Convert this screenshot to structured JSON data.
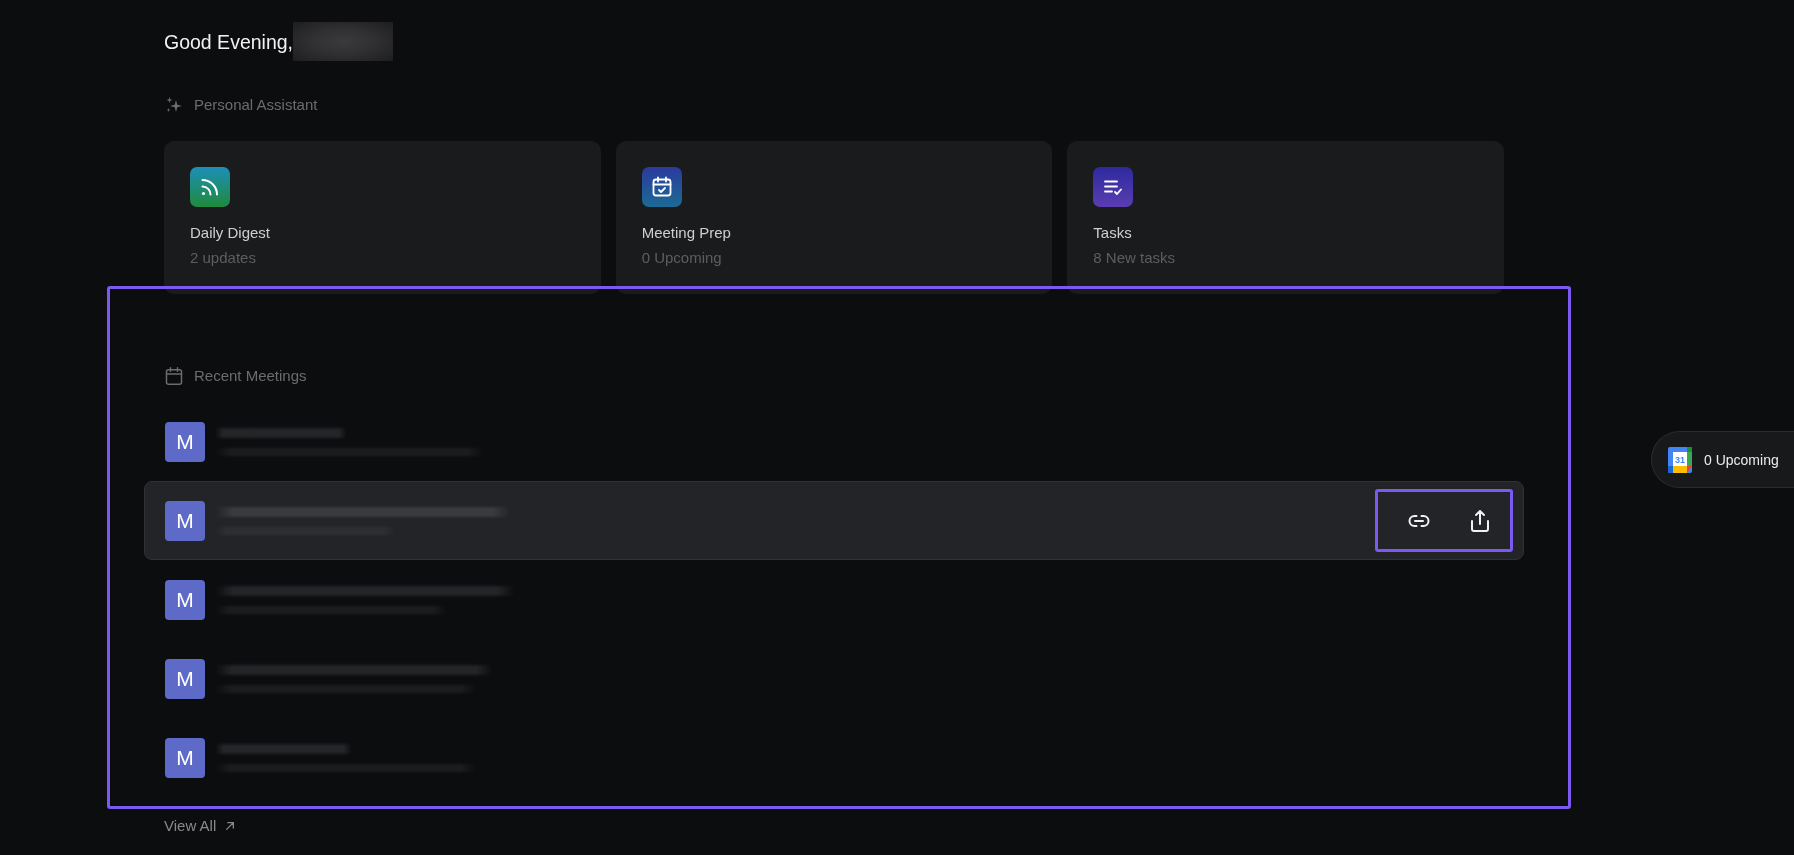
{
  "greeting": {
    "text": "Good Evening,",
    "name_redacted": true
  },
  "personal_assistant": {
    "title": "Personal Assistant",
    "cards": [
      {
        "title": "Daily Digest",
        "subtitle": "2 updates"
      },
      {
        "title": "Meeting Prep",
        "subtitle": "0 Upcoming"
      },
      {
        "title": "Tasks",
        "subtitle": "8 New tasks"
      }
    ]
  },
  "recent_meetings": {
    "title": "Recent Meetings",
    "highlighted": true,
    "meetings": [
      {
        "avatar": "M",
        "hovered": false
      },
      {
        "avatar": "M",
        "hovered": true
      },
      {
        "avatar": "M",
        "hovered": false
      },
      {
        "avatar": "M",
        "hovered": false
      },
      {
        "avatar": "M",
        "hovered": false
      }
    ],
    "row_actions": {
      "highlighted": true
    },
    "view_all": "View All"
  },
  "upcoming_button": {
    "calendar_day": "31",
    "label": "0 Upcoming"
  }
}
